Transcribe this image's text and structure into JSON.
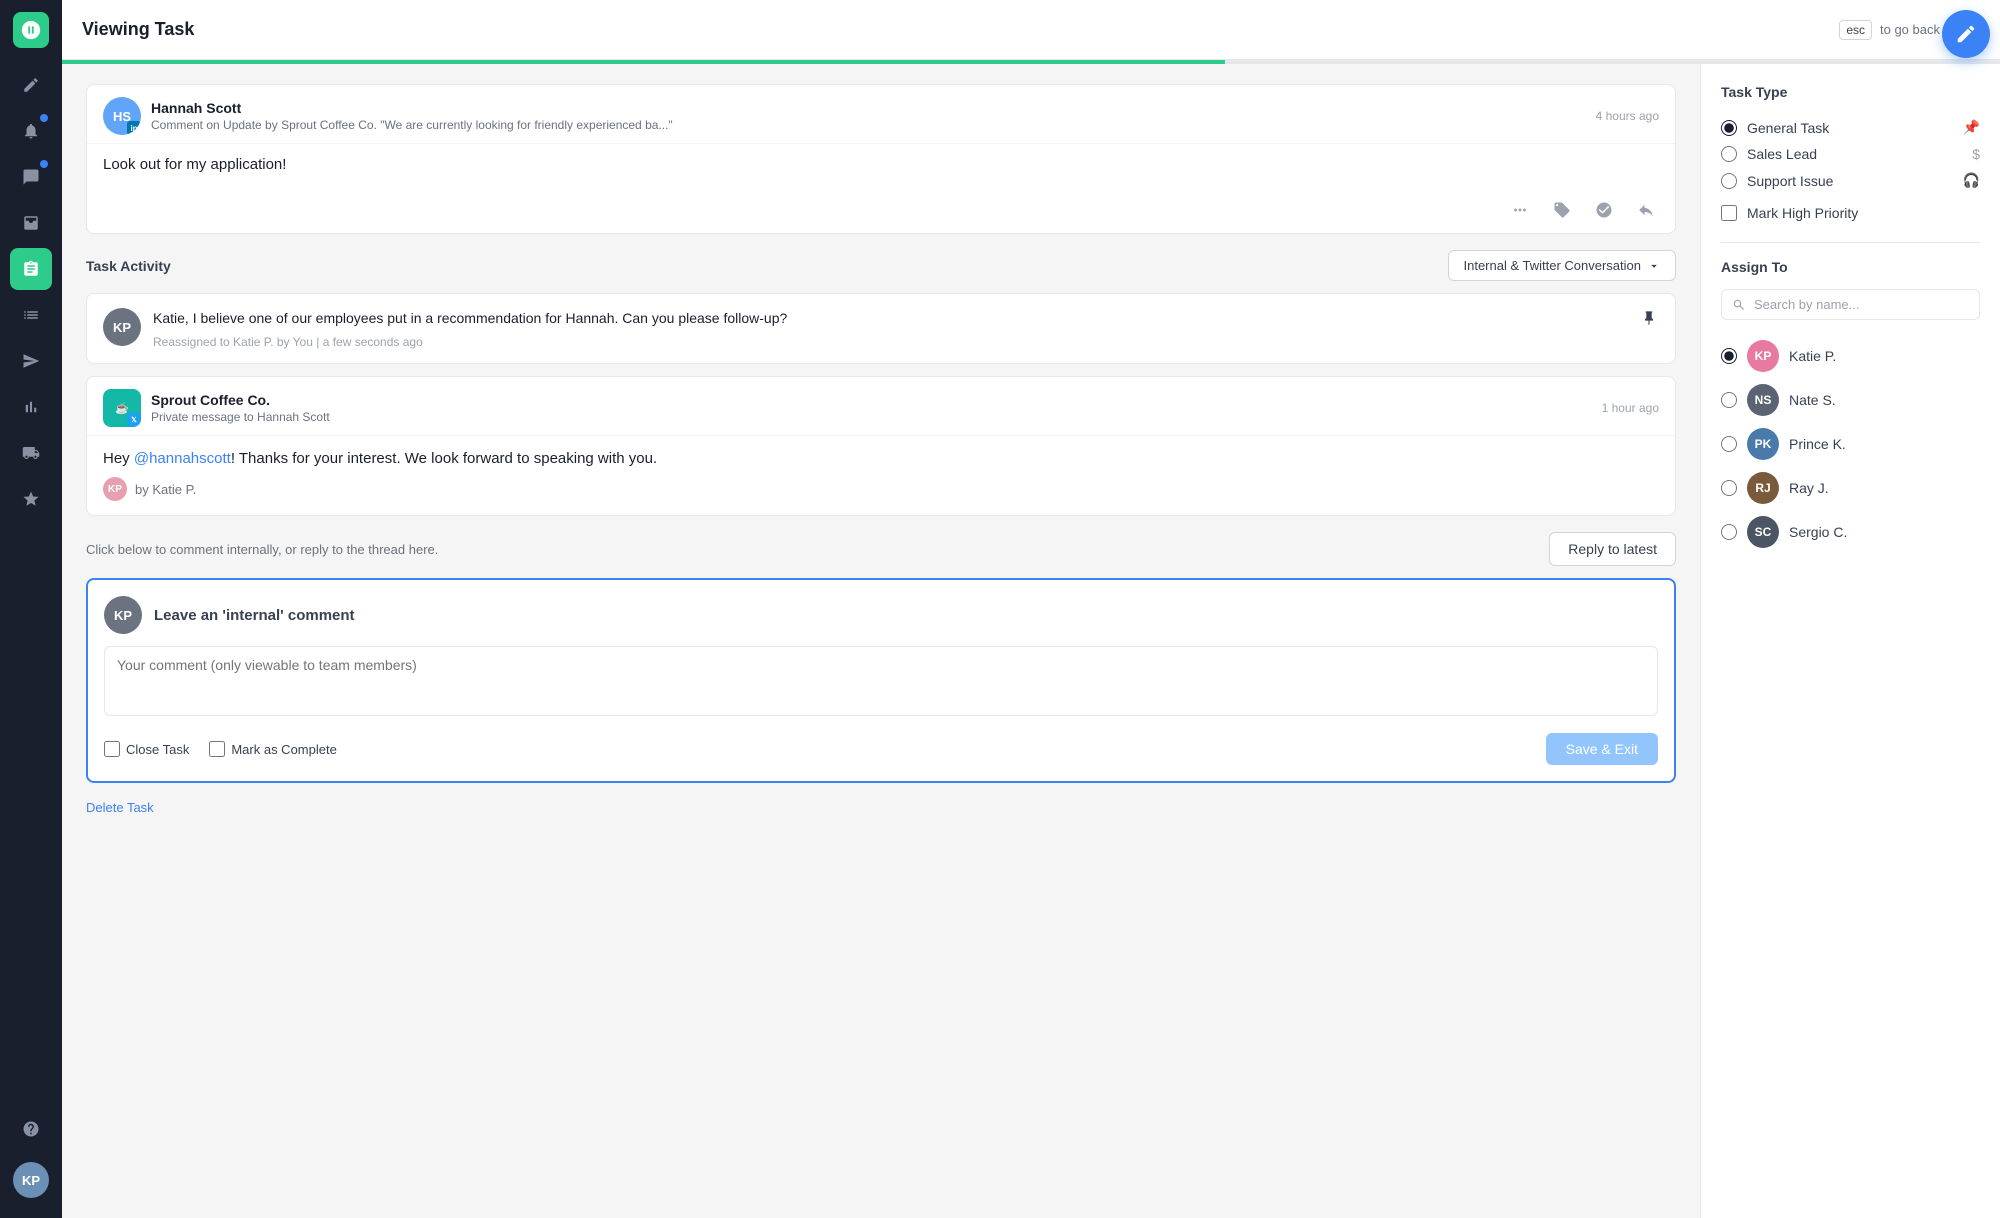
{
  "app": {
    "name": "Sprout Social"
  },
  "topbar": {
    "title": "Viewing Task",
    "esc_label": "esc",
    "go_back_label": "to go back"
  },
  "sidebar": {
    "items": [
      {
        "id": "compose",
        "icon": "compose-icon",
        "active": false
      },
      {
        "id": "notifications",
        "icon": "bell-icon",
        "active": false,
        "badge": true
      },
      {
        "id": "messages",
        "icon": "message-icon",
        "active": false,
        "badge": true
      },
      {
        "id": "inbox",
        "icon": "inbox-icon",
        "active": false
      },
      {
        "id": "tasks",
        "icon": "tasks-icon",
        "active": true
      },
      {
        "id": "lists",
        "icon": "lists-icon",
        "active": false
      },
      {
        "id": "send",
        "icon": "send-icon",
        "active": false
      },
      {
        "id": "analytics",
        "icon": "analytics-icon",
        "active": false
      },
      {
        "id": "automations",
        "icon": "automations-icon",
        "active": false
      },
      {
        "id": "star",
        "icon": "star-icon",
        "active": false
      },
      {
        "id": "help",
        "icon": "help-icon",
        "active": false
      }
    ]
  },
  "message": {
    "author_name": "Hannah Scott",
    "author_initials": "HS",
    "platform": "LinkedIn",
    "subtitle": "Comment on Update by Sprout Coffee Co. \"We are currently looking for friendly experienced ba...\"",
    "time": "4 hours ago",
    "body": "Look out for my application!"
  },
  "task_activity": {
    "section_title": "Task Activity",
    "dropdown_label": "Internal & Twitter Conversation"
  },
  "internal_comment": {
    "author_initials": "KP",
    "text": "Katie, I believe one of our employees put in a recommendation for Hannah. Can you please follow-up?",
    "meta": "Reassigned to Katie P. by You  |  a few seconds ago"
  },
  "private_message": {
    "company_name": "Sprout Coffee Co.",
    "subtitle": "Private message to Hannah Scott",
    "time": "1 hour ago",
    "body_prefix": "Hey ",
    "mention": "@hannahscott",
    "body_suffix": "! Thanks for your interest. We look forward to speaking with you.",
    "by_label": "by Katie P."
  },
  "reply_section": {
    "hint": "Click below to comment internally, or reply to the thread here.",
    "reply_btn_label": "Reply to latest"
  },
  "compose": {
    "author_initials": "KP",
    "title": "Leave an 'internal' comment",
    "placeholder": "Your comment (only viewable to team members)",
    "close_task_label": "Close Task",
    "mark_complete_label": "Mark as Complete",
    "save_btn_label": "Save & Exit"
  },
  "delete_label": "Delete Task",
  "task_type": {
    "section_title": "Task Type",
    "options": [
      {
        "id": "general",
        "label": "General Task",
        "icon": "📌",
        "selected": true
      },
      {
        "id": "sales",
        "label": "Sales Lead",
        "icon": "$",
        "selected": false
      },
      {
        "id": "support",
        "label": "Support Issue",
        "icon": "🎧",
        "selected": false
      }
    ],
    "high_priority": {
      "label": "Mark High Priority",
      "checked": false
    }
  },
  "assign_to": {
    "section_title": "Assign To",
    "search_placeholder": "Search by name...",
    "assignees": [
      {
        "id": "katie",
        "name": "Katie P.",
        "color": "av-pink",
        "initials": "KP",
        "selected": true
      },
      {
        "id": "nate",
        "name": "Nate S.",
        "color": "av-dark",
        "initials": "NS",
        "selected": false
      },
      {
        "id": "prince",
        "name": "Prince K.",
        "color": "av-blue",
        "initials": "PK",
        "selected": false
      },
      {
        "id": "ray",
        "name": "Ray J.",
        "color": "av-brown",
        "initials": "RJ",
        "selected": false
      },
      {
        "id": "sergio",
        "name": "Sergio C.",
        "color": "av-dark",
        "initials": "SC",
        "selected": false
      }
    ]
  }
}
